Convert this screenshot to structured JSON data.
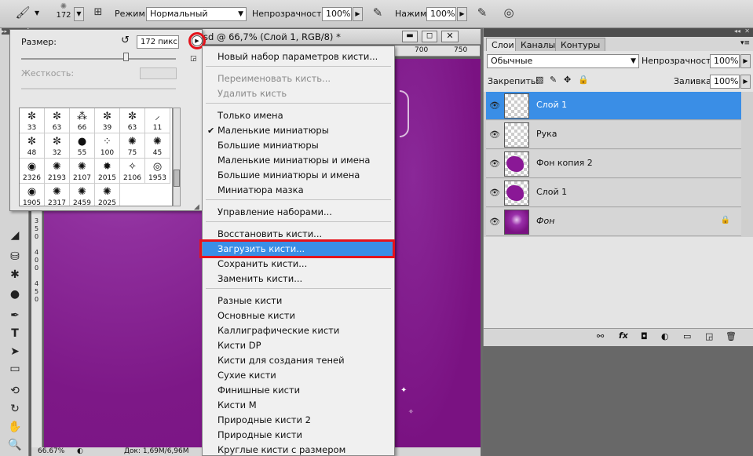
{
  "options_bar": {
    "brush_size_small": "172",
    "mode_label": "Режим:",
    "mode_value": "Нормальный",
    "opacity_label": "Непрозрачность:",
    "opacity_value": "100%",
    "pressure_label": "Нажим:",
    "pressure_value": "100%"
  },
  "brush_panel": {
    "size_label": "Размер:",
    "size_value": "172 пикс.",
    "hardness_label": "Жесткость:",
    "presets": [
      {
        "glyph": "✼",
        "size": "33"
      },
      {
        "glyph": "✼",
        "size": "63"
      },
      {
        "glyph": "⁂",
        "size": "66"
      },
      {
        "glyph": "✼",
        "size": "39"
      },
      {
        "glyph": "✼",
        "size": "63"
      },
      {
        "glyph": "⸝",
        "size": "11"
      },
      {
        "glyph": "✼",
        "size": "48"
      },
      {
        "glyph": "✼",
        "size": "32"
      },
      {
        "glyph": "●",
        "size": "55"
      },
      {
        "glyph": "⁘",
        "size": "100"
      },
      {
        "glyph": "✺",
        "size": "75"
      },
      {
        "glyph": "✺",
        "size": "45"
      },
      {
        "glyph": "◉",
        "size": "2326"
      },
      {
        "glyph": "✺",
        "size": "2193"
      },
      {
        "glyph": "✺",
        "size": "2107"
      },
      {
        "glyph": "✹",
        "size": "2015"
      },
      {
        "glyph": "✧",
        "size": "2106"
      },
      {
        "glyph": "◎",
        "size": "1953"
      },
      {
        "glyph": "◉",
        "size": "1905"
      },
      {
        "glyph": "✺",
        "size": "2317"
      },
      {
        "glyph": "✺",
        "size": "2459"
      },
      {
        "glyph": "✺",
        "size": "2025"
      }
    ]
  },
  "document": {
    "title_fragment": "sd @ 66,7% (Слой 1, RGB/8) *",
    "ruler_marks": [
      "700",
      "750"
    ],
    "zoom": "66.67%",
    "doc_info": "Док: 1,69M/6,96M"
  },
  "flyout_menu": {
    "items": [
      {
        "label": "Новый набор параметров кисти...",
        "state": "normal"
      },
      {
        "label": "Переименовать кисть...",
        "state": "disabled"
      },
      {
        "label": "Удалить кисть",
        "state": "disabled"
      },
      {
        "label": "Только имена",
        "state": "normal"
      },
      {
        "label": "Маленькие миниатюры",
        "state": "checked"
      },
      {
        "label": "Большие миниатюры",
        "state": "normal"
      },
      {
        "label": "Маленькие миниатюры и имена",
        "state": "normal"
      },
      {
        "label": "Большие миниатюры и имена",
        "state": "normal"
      },
      {
        "label": "Миниатюра мазка",
        "state": "normal"
      },
      {
        "label": "Управление наборами...",
        "state": "normal"
      },
      {
        "label": "Восстановить кисти...",
        "state": "normal"
      },
      {
        "label": "Загрузить кисти...",
        "state": "highlighted"
      },
      {
        "label": "Сохранить кисти...",
        "state": "normal"
      },
      {
        "label": "Заменить кисти...",
        "state": "normal"
      },
      {
        "label": "Разные кисти",
        "state": "normal"
      },
      {
        "label": "Основные кисти",
        "state": "normal"
      },
      {
        "label": "Каллиграфические кисти",
        "state": "normal"
      },
      {
        "label": "Кисти DP",
        "state": "normal"
      },
      {
        "label": "Кисти для создания теней",
        "state": "normal"
      },
      {
        "label": "Сухие кисти",
        "state": "normal"
      },
      {
        "label": "Финишные кисти",
        "state": "normal"
      },
      {
        "label": "Кисти M",
        "state": "normal"
      },
      {
        "label": "Природные кисти 2",
        "state": "normal"
      },
      {
        "label": "Природные кисти",
        "state": "normal"
      },
      {
        "label": "Круглые кисти с размером",
        "state": "normal"
      }
    ]
  },
  "layers_panel": {
    "tabs": [
      "Слои",
      "Каналы",
      "Контуры"
    ],
    "blend_mode": "Обычные",
    "opacity_label": "Непрозрачность:",
    "opacity_value": "100%",
    "lock_label": "Закрепить:",
    "fill_label": "Заливка:",
    "fill_value": "100%",
    "layers": [
      {
        "name": "Слой 1",
        "selected": true,
        "thumb": "transparent"
      },
      {
        "name": "Рука",
        "selected": false,
        "thumb": "transparent"
      },
      {
        "name": "Фон копия 2",
        "selected": false,
        "thumb": "purple-shape"
      },
      {
        "name": "Слой 1",
        "selected": false,
        "thumb": "purple-shape"
      },
      {
        "name": "Фон",
        "selected": false,
        "thumb": "purple-full",
        "locked": true
      }
    ]
  },
  "colors": {
    "canvas_purple": "#7d1887",
    "highlight_blue": "#3a8ee6",
    "annotation_red": "#e4131b"
  }
}
